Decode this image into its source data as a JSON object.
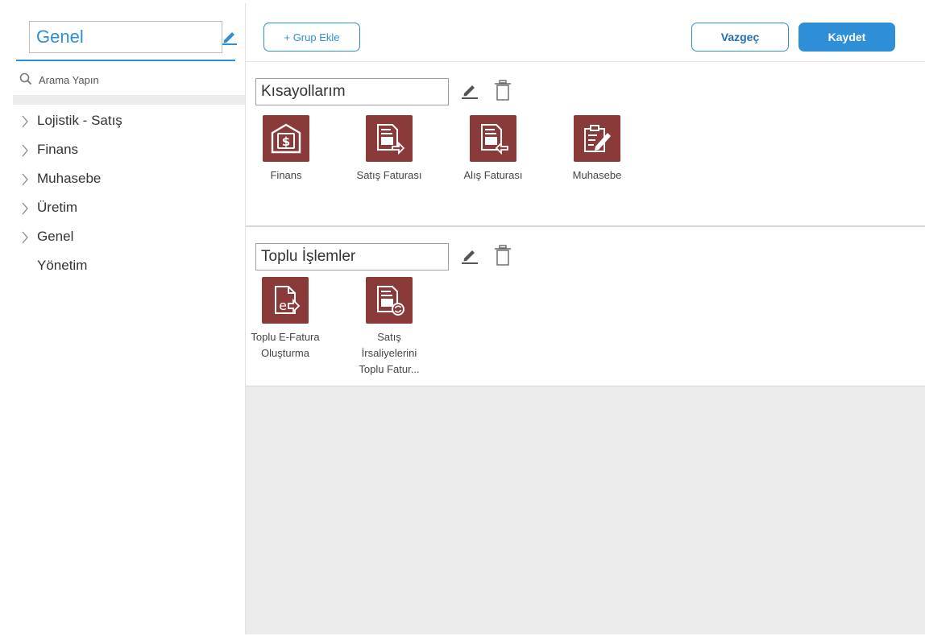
{
  "sidebar": {
    "group_name": "Genel",
    "search_placeholder": "Arama Yapın",
    "items": [
      {
        "label": "Lojistik - Satış",
        "expandable": true
      },
      {
        "label": "Finans",
        "expandable": true
      },
      {
        "label": "Muhasebe",
        "expandable": true
      },
      {
        "label": "Üretim",
        "expandable": true
      },
      {
        "label": "Genel",
        "expandable": true
      },
      {
        "label": "Yönetim",
        "expandable": false
      }
    ]
  },
  "toolbar": {
    "add_group_label": "+ Grup Ekle",
    "cancel_label": "Vazgeç",
    "save_label": "Kaydet"
  },
  "groups": [
    {
      "title": "Kısayollarım",
      "shortcuts": [
        {
          "label": "Finans",
          "icon": "dollar-house-icon"
        },
        {
          "label": "Satış Faturası",
          "icon": "invoice-out-icon"
        },
        {
          "label": "Alış Faturası",
          "icon": "invoice-in-icon"
        },
        {
          "label": "Muhasebe",
          "icon": "ledger-edit-icon"
        }
      ]
    },
    {
      "title": "Toplu İşlemler",
      "shortcuts": [
        {
          "label": "Toplu E-Fatura Oluşturma",
          "icon": "e-invoice-icon"
        },
        {
          "label": "Satış İrsaliyelerini Toplu Fatur...",
          "icon": "invoice-refresh-icon"
        }
      ]
    }
  ],
  "colors": {
    "accent": "#2f8fd6",
    "tile": "#8b3a3a",
    "workspace_bg": "#ebebeb"
  }
}
